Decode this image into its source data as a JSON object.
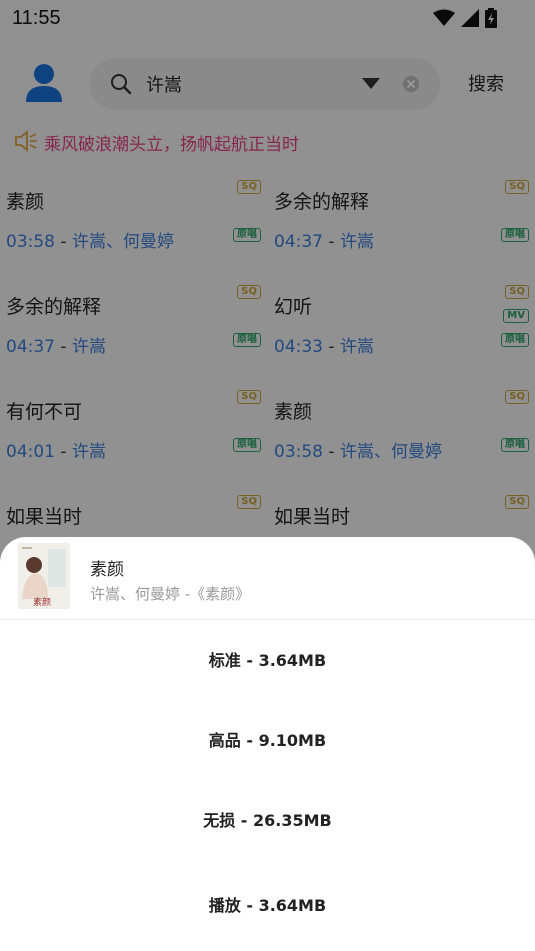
{
  "status_bar": {
    "time": "11:55"
  },
  "search": {
    "query": "许嵩",
    "button_label": "搜索"
  },
  "notice": {
    "text": "乘风破浪潮头立，扬帆起航正当时"
  },
  "badges": {
    "sq": "SQ",
    "mv": "MV",
    "original": "原唱"
  },
  "songs": [
    {
      "title": "素颜",
      "duration": "03:58",
      "artist": "许嵩、何曼婷",
      "mv": false
    },
    {
      "title": "多余的解释",
      "duration": "04:37",
      "artist": "许嵩",
      "mv": false
    },
    {
      "title": "多余的解释",
      "duration": "04:37",
      "artist": "许嵩",
      "mv": false
    },
    {
      "title": "幻听",
      "duration": "04:33",
      "artist": "许嵩",
      "mv": true
    },
    {
      "title": "有何不可",
      "duration": "04:01",
      "artist": "许嵩",
      "mv": false
    },
    {
      "title": "素颜",
      "duration": "03:58",
      "artist": "许嵩、何曼婷",
      "mv": false
    },
    {
      "title": "如果当时",
      "duration": "",
      "artist": "",
      "mv": false
    },
    {
      "title": "如果当时",
      "duration": "",
      "artist": "",
      "mv": false
    }
  ],
  "sheet": {
    "title": "素颜",
    "subtitle": "许嵩、何曼婷 -《素颜》",
    "cover_text": "素颜",
    "options": [
      {
        "label": "标准 - 3.64MB"
      },
      {
        "label": "高品 - 9.10MB"
      },
      {
        "label": "无损 - 26.35MB"
      },
      {
        "label": "播放 - 3.64MB"
      }
    ]
  },
  "colors": {
    "accent_blue": "#3a7bd5",
    "notice_pink": "#e0407a",
    "sq_gold": "#c9a13c",
    "green": "#2ea06a"
  }
}
